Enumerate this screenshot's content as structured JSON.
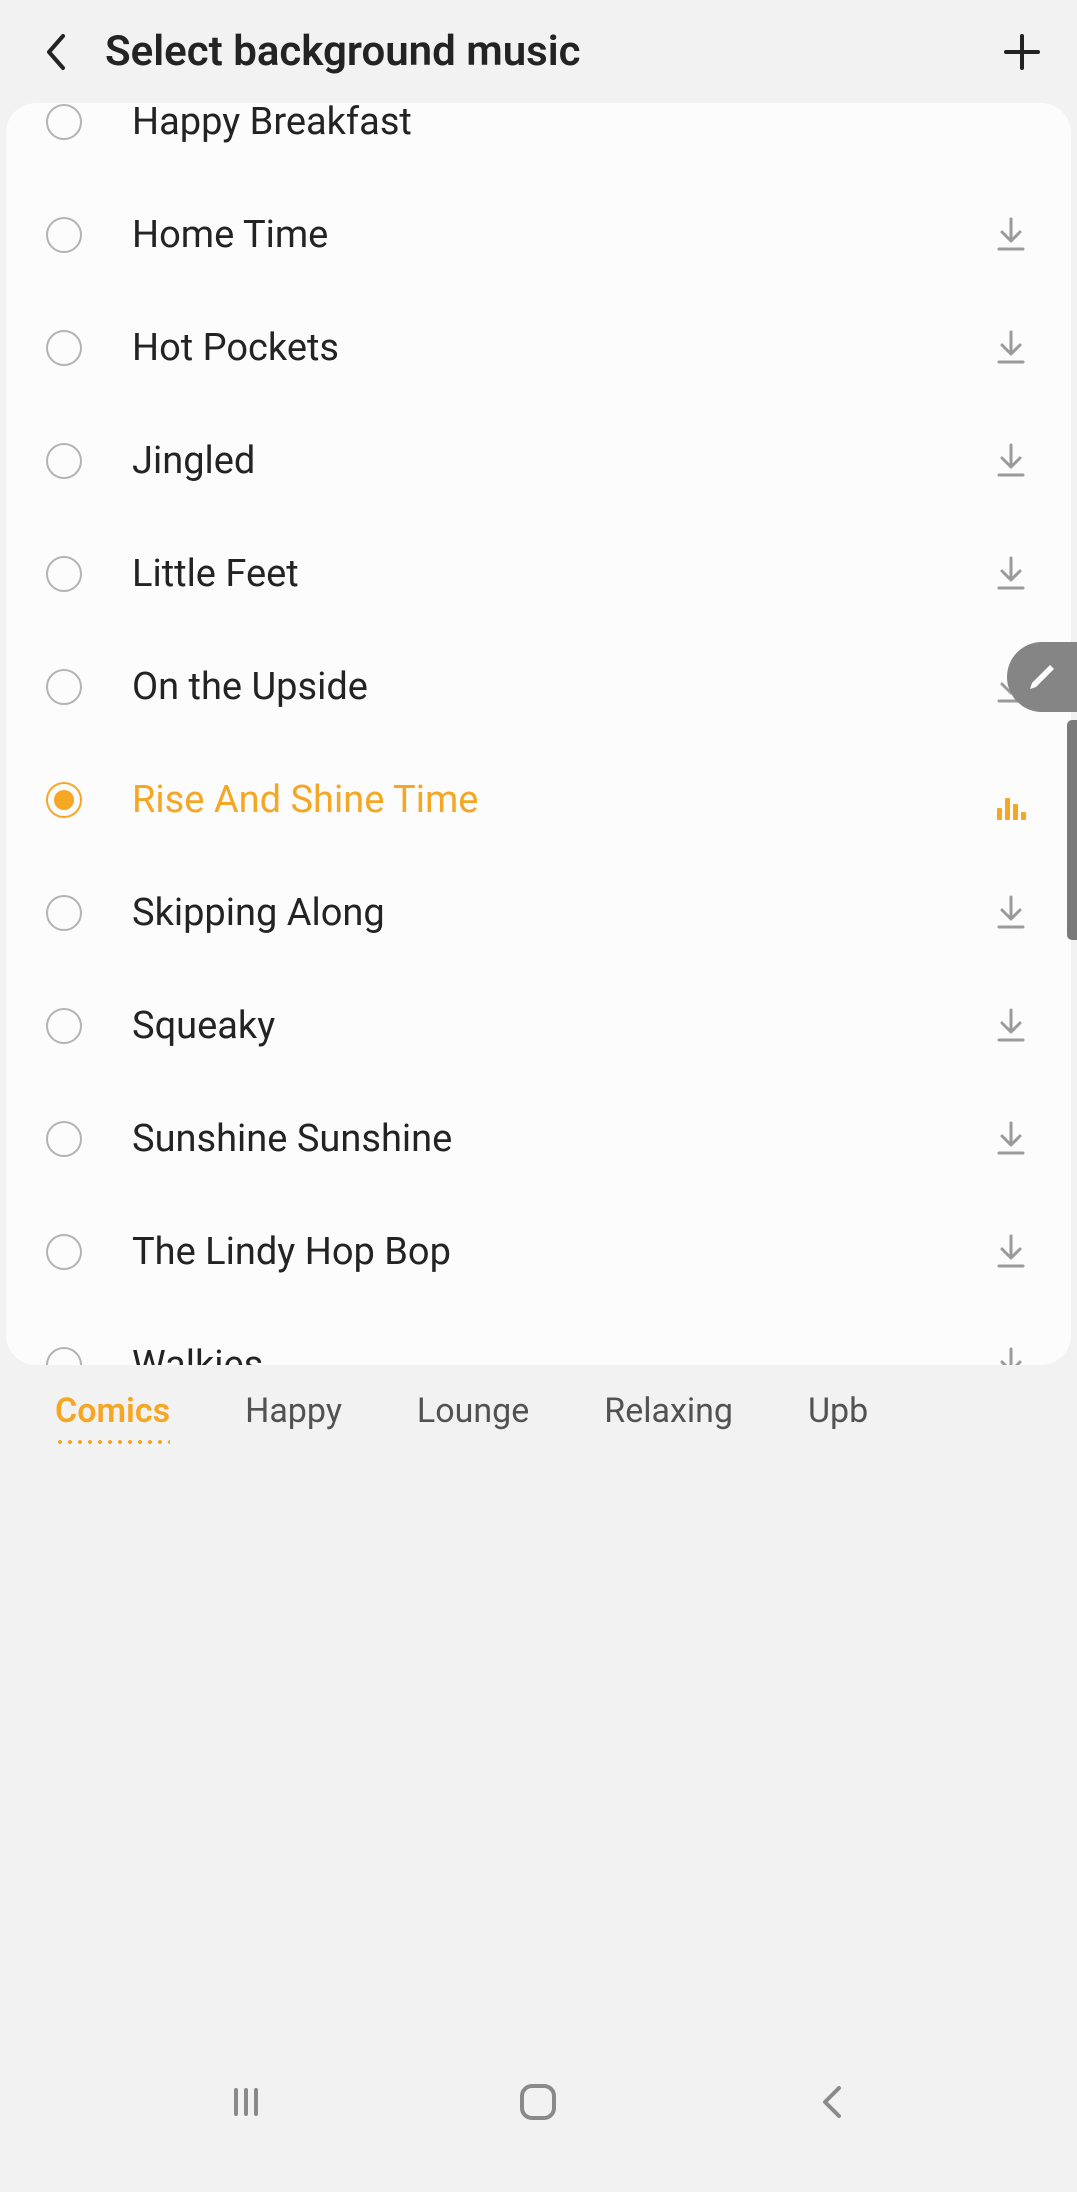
{
  "header": {
    "title": "Select background music"
  },
  "music_items": [
    {
      "label": "Happy Breakfast",
      "selected": false,
      "downloadable": false
    },
    {
      "label": "Home Time",
      "selected": false,
      "downloadable": true
    },
    {
      "label": "Hot Pockets",
      "selected": false,
      "downloadable": true
    },
    {
      "label": "Jingled",
      "selected": false,
      "downloadable": true
    },
    {
      "label": "Little Feet",
      "selected": false,
      "downloadable": true
    },
    {
      "label": "On the Upside",
      "selected": false,
      "downloadable": true
    },
    {
      "label": "Rise And Shine Time",
      "selected": true,
      "downloadable": false,
      "playing": true
    },
    {
      "label": "Skipping Along",
      "selected": false,
      "downloadable": true
    },
    {
      "label": "Squeaky",
      "selected": false,
      "downloadable": true
    },
    {
      "label": "Sunshine Sunshine",
      "selected": false,
      "downloadable": true
    },
    {
      "label": "The Lindy Hop Bop",
      "selected": false,
      "downloadable": true
    },
    {
      "label": "Walkies",
      "selected": false,
      "downloadable": true
    }
  ],
  "tabs": [
    {
      "label": "Comics",
      "active": true
    },
    {
      "label": "Happy",
      "active": false
    },
    {
      "label": "Lounge",
      "active": false
    },
    {
      "label": "Relaxing",
      "active": false
    },
    {
      "label": "Upb",
      "active": false
    }
  ],
  "colors": {
    "accent": "#f5a623",
    "text": "#232323",
    "border": "#b3b3b3"
  }
}
